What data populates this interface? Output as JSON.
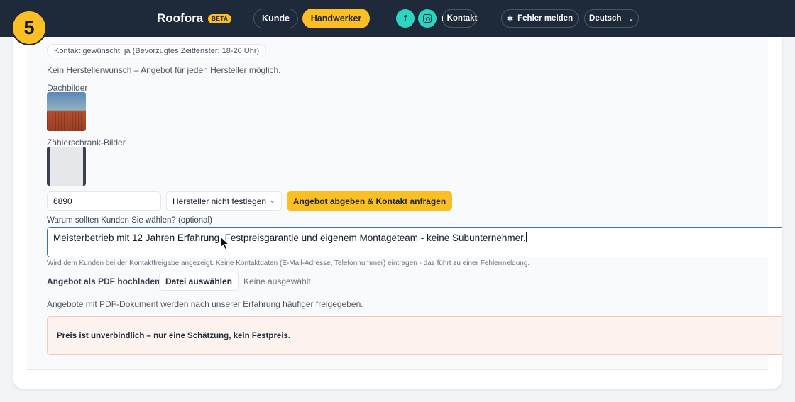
{
  "step_badge": "5",
  "nav": {
    "brand": "Roofora",
    "beta": "BETA",
    "kunde": "Kunde",
    "handwerker": "Handwerker",
    "facebook": "f",
    "kontakt": "Kontakt",
    "fehler": "Fehler melden",
    "language": "Deutsch"
  },
  "request": {
    "contact_chip": "Kontakt gewünscht: ja (Bevorzugtes Zeitfenster: 18-20 Uhr)",
    "manufacturer_note": "Kein Herstellerwunsch – Angebot für jeden Hersteller möglich.",
    "roof_images_label": "Dachbilder",
    "meter_images_label": "Zählerschrank-Bilder"
  },
  "offer": {
    "price_value": "6890",
    "manufacturer_select": "Hersteller nicht festlegen",
    "submit_label": "Angebot abgeben & Kontakt anfragen",
    "why_label": "Warum sollten Kunden Sie wählen? (optional)",
    "why_value": "Meisterbetrieb mit 12 Jahren Erfahrung, Festpreisgarantie und eigenem Montageteam - keine Subunternehmer.",
    "why_hint": "Wird dem Kunden bei der Kontaktfreigabe angezeigt. Keine Kontaktdaten (E-Mail-Adresse, Telefonnummer) eintragen - das führt zu einer Fehlermeldung.",
    "pdf_label": "Angebot als PDF hochladen:",
    "file_button": "Datei auswählen",
    "file_status": "Keine ausgewählt",
    "pdf_note": "Angebote mit PDF-Dokument werden nach unserer Erfahrung häufiger freigegeben.",
    "warning": "Preis ist unverbindlich – nur eine Schätzung, kein Festpreis."
  },
  "colors": {
    "accent": "#fbbf24",
    "nav_bg": "#1e2a3a",
    "social": "#2dd4bf",
    "focus_border": "#3b6fb6"
  }
}
